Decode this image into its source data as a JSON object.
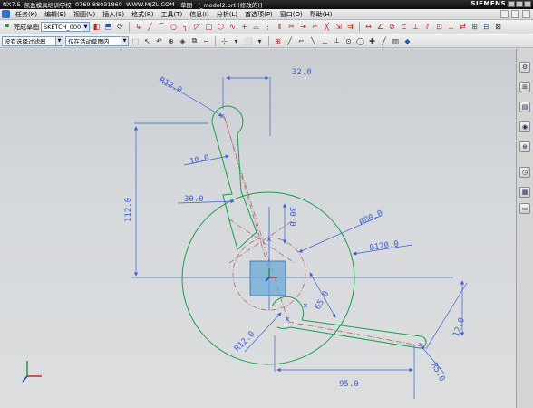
{
  "title": {
    "app": "NX7.5",
    "training": "凯盈模具培训学校",
    "phone": "0769-88031860",
    "site": "WWW.MJZL.COM",
    "mode": "草图",
    "file": "[_model2.prt (修改的)]",
    "brand": "SIEMENS"
  },
  "menu": [
    "任务(K)",
    "编辑(E)",
    "视图(V)",
    "插入(S)",
    "格式(R)",
    "工具(T)",
    "信息(I)",
    "分析(L)",
    "首选项(P)",
    "窗口(O)",
    "帮助(H)"
  ],
  "toolbar": {
    "finish_sketch": "完成草图",
    "sketch_name": "SKETCH_000",
    "filter": "没有选择过滤器",
    "scope": "仅在活动草图内"
  },
  "dimensions": {
    "r12_top": "R12.0",
    "d32": "32.0",
    "d112": "112.0",
    "d10": "10.0",
    "d30_h": "30.0",
    "d30_v": "30.0",
    "dia80": "Ø80.0",
    "dia120": "Ø120.0",
    "d65": "65.0",
    "d12": "12.0",
    "r12_bottom": "R12.0",
    "d95": "95.0",
    "r5": "R5.0"
  },
  "colors": {
    "geometry": "#1a9e4a",
    "dimension": "#3d5fd0",
    "construction": "#b06a6a",
    "selection": "#6aa9d6"
  }
}
